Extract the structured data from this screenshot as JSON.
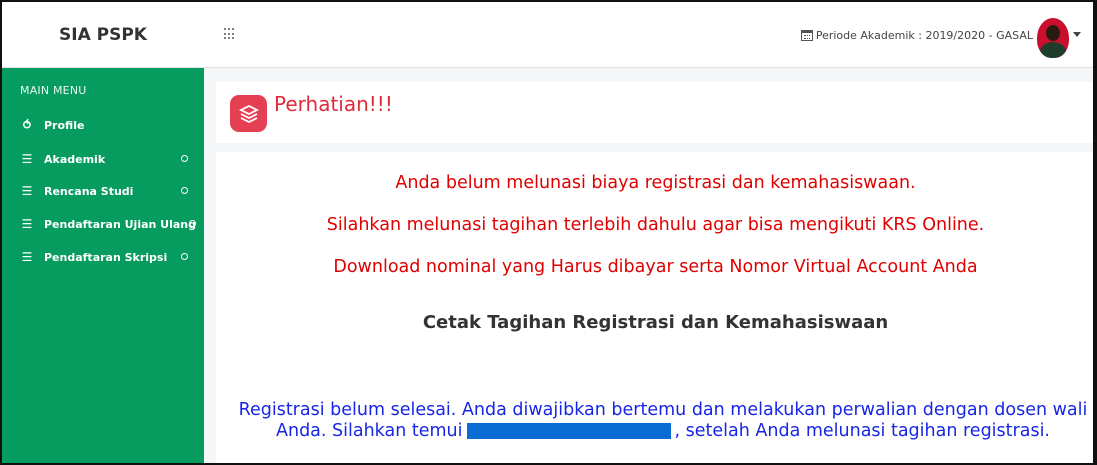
{
  "header": {
    "brand": "SIA PSPK",
    "periode": "Periode Akademik : 2019/2020 - GASAL"
  },
  "sidebar": {
    "title": "MAIN MENU",
    "items": [
      {
        "label": "Profile",
        "icon": "chart-icon"
      },
      {
        "label": "Akademik",
        "icon": "layers-icon"
      },
      {
        "label": "Rencana Studi",
        "icon": "layers-icon"
      },
      {
        "label": "Pendaftaran Ujian Ulang",
        "icon": "layers-icon"
      },
      {
        "label": "Pendaftaran Skripsi",
        "icon": "layers-icon"
      }
    ]
  },
  "notice": {
    "title": "Perhatian!!!",
    "line1": "Anda belum melunasi biaya registrasi dan kemahasiswaan.",
    "line2": "Silahkan melunasi tagihan terlebih dahulu agar bisa mengikuti KRS Online.",
    "line3": "Download nominal yang Harus dibayar serta Nomor Virtual Account Anda",
    "cetak": "Cetak Tagihan Registrasi dan Kemahasiswaan",
    "registrasi_a": "Registrasi belum selesai. Anda diwajibkan bertemu dan melakukan perwalian dengan dosen wali Anda. Silahkan temui",
    "registrasi_b": ", setelah Anda melunasi tagihan registrasi."
  },
  "colors": {
    "sidebar": "#069b5f",
    "alert_red": "#e00000",
    "info_blue": "#1726e6",
    "icon_red": "#e53f54"
  }
}
